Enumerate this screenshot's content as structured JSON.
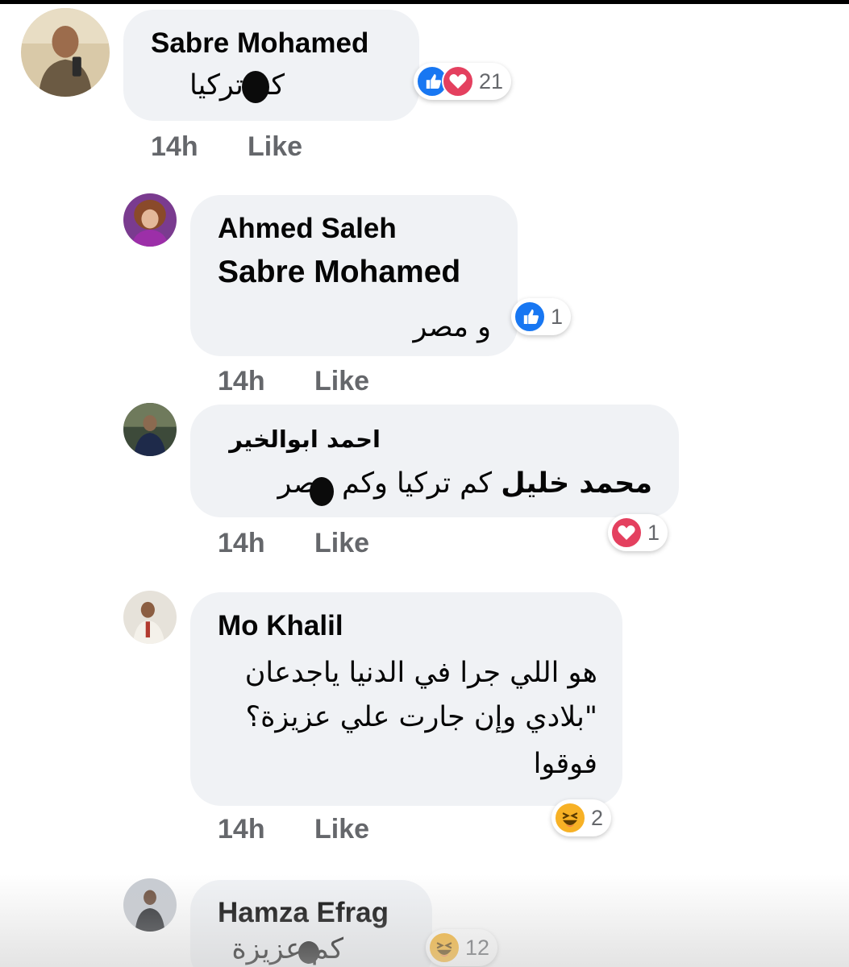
{
  "colors": {
    "bubble_bg": "#f0f2f5",
    "meta_text": "#65676b",
    "like_blue": "#1877f2",
    "love_red": "#e4405f",
    "haha_yellow": "#f7b125"
  },
  "comments": [
    {
      "author": "Sabre Mohamed",
      "text": "كم تركيا",
      "time": "14h",
      "like_label": "Like",
      "reactions": {
        "icons": [
          "like-icon",
          "love-icon"
        ],
        "count": "21"
      }
    },
    {
      "author": "Ahmed Saleh",
      "mention": "Sabre Mohamed",
      "text": "و مصر",
      "time": "14h",
      "like_label": "Like",
      "reactions": {
        "icons": [
          "like-icon"
        ],
        "count": "1"
      }
    },
    {
      "author": "احمد ابوالخير",
      "mention": "محمد خليل",
      "text": "كم تركيا وكم مصر",
      "time": "14h",
      "like_label": "Like",
      "reactions": {
        "icons": [
          "love-icon"
        ],
        "count": "1"
      }
    },
    {
      "author": "Mo Khalil",
      "text_lines": [
        "هو اللي جرا في الدنيا ياجدعان",
        "\"بلادي وإن جارت علي عزيزة؟",
        "فوقوا"
      ],
      "time": "14h",
      "like_label": "Like",
      "reactions": {
        "icons": [
          "haha-icon"
        ],
        "count": "2"
      }
    },
    {
      "author": "Hamza Efrag",
      "text": "كم عزيزة",
      "reactions": {
        "icons": [
          "haha-icon"
        ],
        "count": "12"
      }
    }
  ]
}
